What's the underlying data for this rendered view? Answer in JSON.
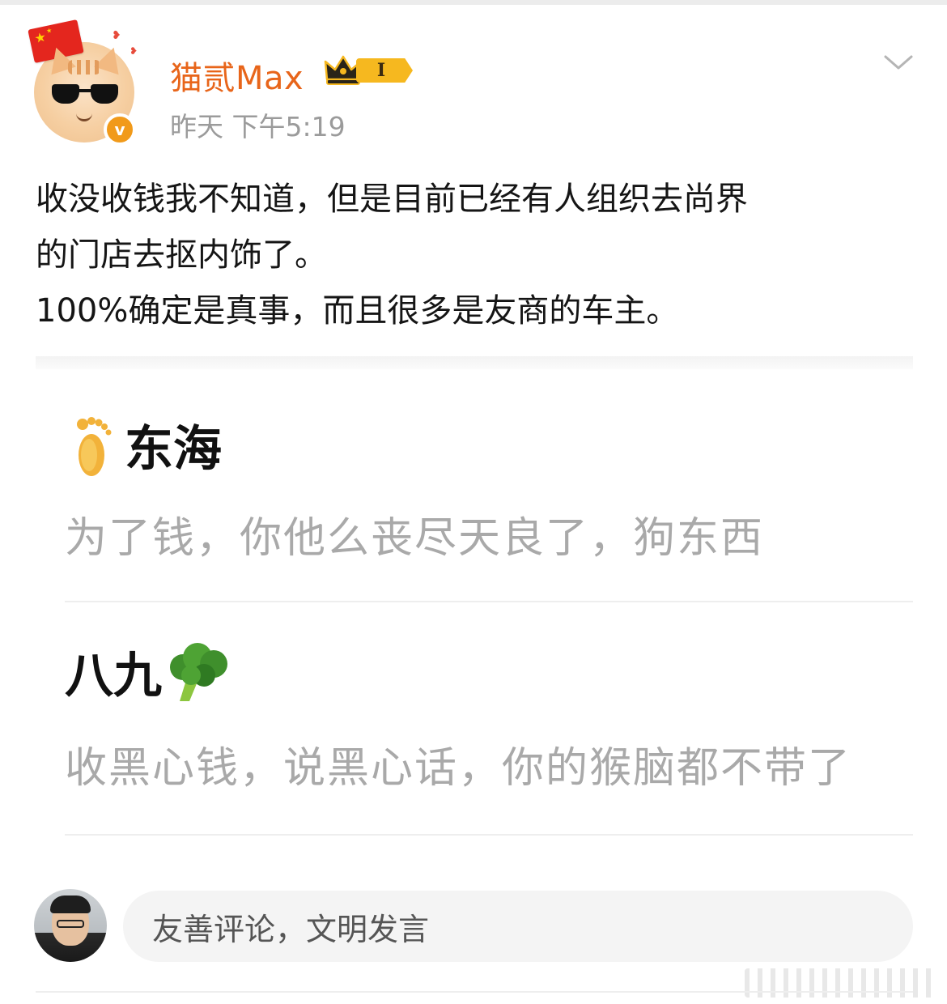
{
  "post": {
    "username": "猫贰Max",
    "vip_level": "I",
    "timestamp": "昨天 下午5:19",
    "verified_mark": "v",
    "body_lines": [
      "收没收钱我不知道，但是目前已经有人组织去尚界",
      "的门店去抠内饰了。",
      "100%确定是真事，而且很多是友商的车主。"
    ]
  },
  "quoted_comments": [
    {
      "author": "东海",
      "author_icon": "foot-emoji",
      "text": "为了钱，你他么丧尽天良了，狗东西"
    },
    {
      "author": "八九",
      "author_icon": "broccoli-emoji",
      "text": "收黑心钱，说黑心话，你的猴脑都不带了"
    }
  ],
  "comment_bar": {
    "placeholder": "友善评论，文明发言"
  },
  "colors": {
    "username": "#e8651a",
    "timestamp": "#9b9b9b",
    "comment_text": "#a9a9a9",
    "verified": "#f19a1a",
    "vip": "#f6b81f"
  }
}
